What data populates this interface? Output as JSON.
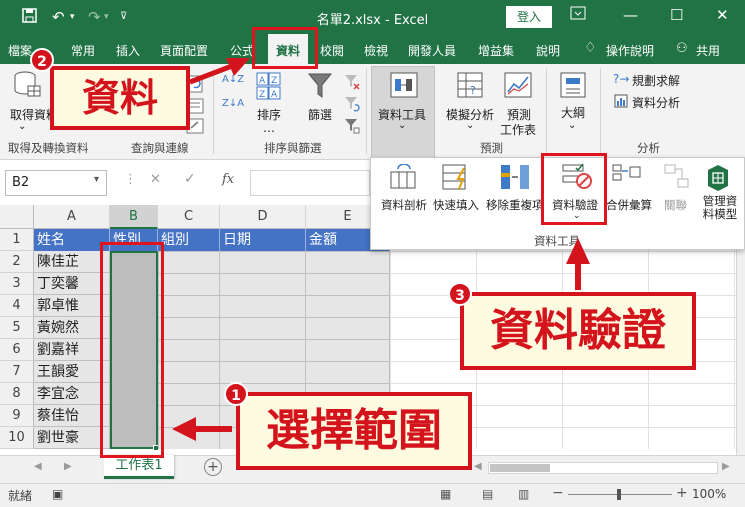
{
  "window": {
    "title": "名單2.xlsx - Excel",
    "login_label": "登入"
  },
  "tabs": [
    "檔案",
    "常用",
    "插入",
    "頁面配置",
    "公式",
    "資料",
    "校閱",
    "檢視",
    "開發人員",
    "增益集",
    "說明"
  ],
  "tell_me": "操作說明",
  "share_label": "共用",
  "ribbon": {
    "get_data": "取得資料",
    "sort": "排序",
    "filter": "篩選",
    "data_tools": "資料工具",
    "what_if": "模擬分析",
    "forecast_sheet": "預測工作表",
    "outline": "大綱",
    "solver": "規劃求解",
    "data_analysis": "資料分析",
    "groups": {
      "get_transform": "取得及轉換資料",
      "queries": "查詢與連線",
      "sort_filter": "排序與篩選",
      "forecast": "預測",
      "analysis": "分析"
    }
  },
  "formula_bar": {
    "name_box": "B2",
    "fx": "fx"
  },
  "data_tools_popup": {
    "items": [
      "資料剖析",
      "快速填入",
      "移除重複項",
      "資料驗證",
      "合併彙算",
      "關聯",
      "管理資料模型"
    ],
    "group_label": "資料工具"
  },
  "sheet": {
    "columns": [
      "A",
      "B",
      "C",
      "D",
      "E"
    ],
    "rows": [
      "1",
      "2",
      "3",
      "4",
      "5",
      "6",
      "7",
      "8",
      "9",
      "10"
    ],
    "headers": [
      "姓名",
      "性別",
      "組別",
      "日期",
      "金額"
    ],
    "names": [
      "陳佳芷",
      "丁奕馨",
      "郭卓惟",
      "黃婉然",
      "劉嘉祥",
      "王韻愛",
      "李宜念",
      "蔡佳怡",
      "劉世豪"
    ]
  },
  "sheet_tab": "工作表1",
  "status": {
    "ready": "就緒",
    "zoom": "100%"
  },
  "annotations": {
    "badge1": "1",
    "badge2": "2",
    "badge3": "3",
    "select_range": "選擇範圍",
    "data_tab": "資料",
    "data_validation": "資料驗證"
  },
  "colors": {
    "excel_green": "#217346",
    "header_blue": "#4472c4",
    "annotation_red": "#d4141c",
    "callout_fill": "#fffbe0"
  }
}
